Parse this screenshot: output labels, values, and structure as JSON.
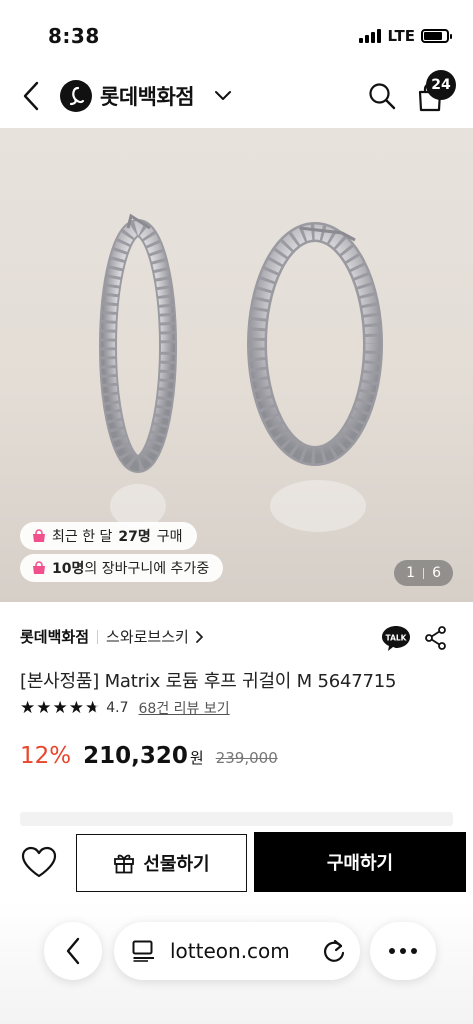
{
  "status_bar": {
    "time": "8:38",
    "network": "LTE"
  },
  "top_nav": {
    "brand_name": "롯데백화점",
    "cart_count": "24",
    "icons": [
      "back-icon",
      "lotte-logo-icon",
      "chevron-down-icon",
      "search-icon",
      "shopping-bag-icon"
    ]
  },
  "gallery": {
    "recent_buyers": {
      "prefix": "최근 한 달 ",
      "count": "27명",
      "suffix": " 구매"
    },
    "cart_adds": {
      "count": "10명",
      "suffix": "의 장바구니에 추가중"
    },
    "current_index": "1",
    "total": "6"
  },
  "product": {
    "seller": "롯데백화점",
    "brand": "스와로브스키",
    "title": "[본사정품] Matrix 로듐 후프 귀걸이 M 5647715",
    "rating": "4.7",
    "stars": 4.7,
    "review_link": "68건 리뷰 보기",
    "discount": "12%",
    "price": "210,320",
    "currency": "원",
    "original_price": "239,000"
  },
  "purchase_bar": {
    "gift_label": "선물하기",
    "buy_label": "구매하기"
  },
  "browser": {
    "url": "lotteon.com"
  },
  "colors": {
    "discount": "#e8452c",
    "badge_bag": "#f0508c",
    "buy_button": "#000000"
  }
}
